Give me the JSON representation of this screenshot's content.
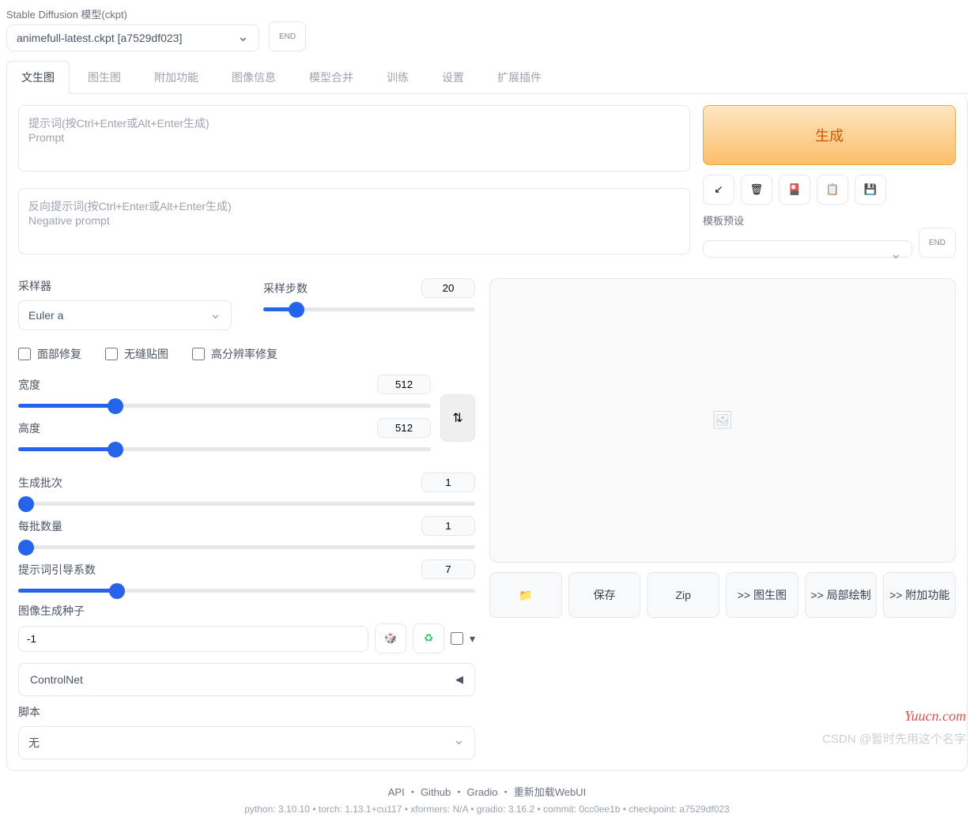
{
  "header": {
    "model_label": "Stable Diffusion 模型(ckpt)",
    "model_value": "animefull-latest.ckpt [a7529df023]",
    "refresh_icon": "↩"
  },
  "tabs": [
    "文生图",
    "图生图",
    "附加功能",
    "图像信息",
    "模型合并",
    "训练",
    "设置",
    "扩展插件"
  ],
  "active_tab": 0,
  "prompt": {
    "placeholder": "提示词(按Ctrl+Enter或Alt+Enter生成)\nPrompt",
    "value": ""
  },
  "neg_prompt": {
    "placeholder": "反向提示词(按Ctrl+Enter或Alt+Enter生成)\nNegative prompt",
    "value": ""
  },
  "generate_label": "生成",
  "tool_icons": [
    "↙",
    "🗑",
    "🎴",
    "📋",
    "💾"
  ],
  "preset": {
    "label": "模板预设",
    "value": "",
    "back_icon": "↩"
  },
  "sampler": {
    "label": "采样器",
    "value": "Euler a"
  },
  "steps": {
    "label": "采样步数",
    "value": 20
  },
  "checkboxes": {
    "face": {
      "label": "面部修复",
      "checked": false
    },
    "tile": {
      "label": "无缝贴图",
      "checked": false
    },
    "hires": {
      "label": "高分辨率修复",
      "checked": false
    }
  },
  "width": {
    "label": "宽度",
    "value": 512
  },
  "height": {
    "label": "高度",
    "value": 512
  },
  "swap_icon": "⇅",
  "batch_count": {
    "label": "生成批次",
    "value": 1
  },
  "batch_size": {
    "label": "每批数量",
    "value": 1
  },
  "cfg": {
    "label": "提示词引导系数",
    "value": 7
  },
  "seed": {
    "label": "图像生成种子",
    "value": "-1",
    "dice": "🎲",
    "recycle": "♻",
    "extra": "▾"
  },
  "controlnet": {
    "label": "ControlNet",
    "arrow": "◀"
  },
  "script": {
    "label": "脚本",
    "value": "无"
  },
  "preview_icon": "🖼",
  "actions": {
    "folder": "📁",
    "save": "保存",
    "zip": "Zip",
    "img2img": ">> 图生图",
    "inpaint": ">> 局部绘制",
    "extras": ">> 附加功能"
  },
  "footer": {
    "links": "API ・ Github ・ Gradio ・ 重新加载WebUI",
    "meta": "python: 3.10.10  •  torch: 1.13.1+cu117  •  xformers: N/A  •  gradio: 3.16.2  •  commit: 0cc0ee1b  •  checkpoint: a7529df023"
  },
  "watermarks": {
    "w1": "Yuucn.com",
    "w2": "CSDN @暂时先用这个名字"
  }
}
